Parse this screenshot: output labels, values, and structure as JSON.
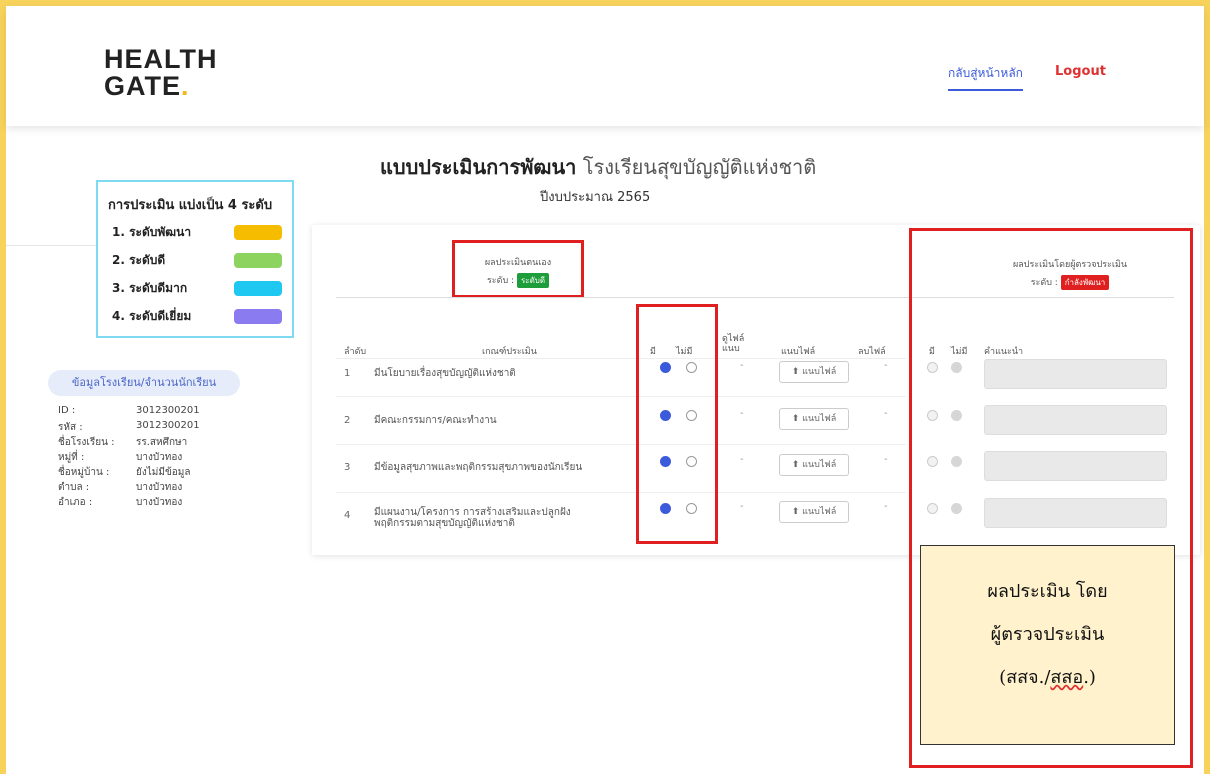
{
  "header": {
    "logo_line1": "HEALTH",
    "logo_line2": "GATE",
    "logo_dot": ".",
    "nav_home": "กลับสู่หน้าหลัก",
    "nav_logout": "Logout"
  },
  "page": {
    "title_bold": "แบบประเมินการพัฒนา",
    "title_school": "โรงเรียนสุขบัญญัติแห่งชาติ",
    "subtitle": "ปีงบประมาณ 2565"
  },
  "legend": {
    "title": "การประเมิน แบ่งเป็น 4 ระดับ",
    "items": [
      {
        "label": "1. ระดับพัฒนา",
        "color": "#f5bc00"
      },
      {
        "label": "2. ระดับดี",
        "color": "#8dd35f"
      },
      {
        "label": "3. ระดับดีมาก",
        "color": "#1ec8f0"
      },
      {
        "label": "4. ระดับดีเยี่ยม",
        "color": "#8a7cf0"
      }
    ]
  },
  "school": {
    "pill": "ข้อมูลโรงเรียน/จำนวนนักเรียน",
    "rows": [
      {
        "k": "ID :",
        "v": "3012300201"
      },
      {
        "k": "รหัส :",
        "v": "3012300201"
      },
      {
        "k": "ชื่อโรงเรียน :",
        "v": "รร.สหศึกษา"
      },
      {
        "k": "หมู่ที่ :",
        "v": "บางบัวทอง"
      },
      {
        "k": "ชื่อหมู่บ้าน :",
        "v": "ยังไม่มีข้อมูล"
      },
      {
        "k": "ตำบล :",
        "v": "บางบัวทอง"
      },
      {
        "k": "อำเภอ :",
        "v": "บางบัวทอง"
      }
    ]
  },
  "self_eval": {
    "title": "ผลประเมินตนเอง",
    "level_label": "ระดับ :",
    "level_badge": "ระดับดี",
    "badge_color": "#1e9e3a"
  },
  "reviewer_eval": {
    "title": "ผลประเมินโดยผู้ตรวจประเมิน",
    "level_label": "ระดับ :",
    "level_badge": "กำลังพัฒนา",
    "badge_color": "#e02020"
  },
  "table": {
    "col_no": "ลำดับ",
    "col_criteria": "เกณฑ์ประเมิน",
    "col_yes": "มี",
    "col_no_have": "ไม่มี",
    "col_file_view_1": "ดูไฟล์",
    "col_file_view_2": "แนบ",
    "col_attach": "แนบไฟล์",
    "col_delete": "ลบไฟล์",
    "col_rev_yes": "มี",
    "col_rev_no": "ไม่มี",
    "col_advice": "คำแนะนำ",
    "upload_label": "แนบไฟล์",
    "dash": "-",
    "rows": [
      {
        "no": "1",
        "criteria": "มีนโยบายเรื่องสุขบัญญัติแห่งชาติ",
        "criteria2": ""
      },
      {
        "no": "2",
        "criteria": "มีคณะกรรมการ/คณะทำงาน",
        "criteria2": ""
      },
      {
        "no": "3",
        "criteria": "มีข้อมูลสุขภาพและพฤติกรรมสุขภาพของนักเรียน",
        "criteria2": ""
      },
      {
        "no": "4",
        "criteria": "มีแผนงาน/โครงการ การสร้างเสริมและปลูกฝัง",
        "criteria2": "พฤติกรรมตามสุขบัญญัติแห่งชาติ"
      }
    ]
  },
  "note": {
    "line1": "ผลประเมิน โดย",
    "line2": "ผู้ตรวจประเมิน",
    "line3_pre": "(สสจ./",
    "line3_wavy": "สสอ",
    "line3_post": ".)"
  }
}
